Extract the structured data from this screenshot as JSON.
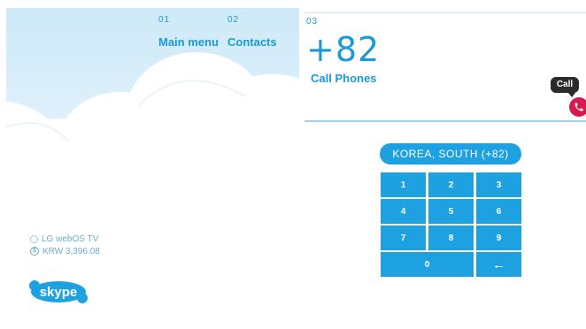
{
  "nav": {
    "main_menu": {
      "num": "01",
      "label": "Main menu"
    },
    "contacts": {
      "num": "02",
      "label": "Contacts"
    }
  },
  "account": {
    "device": "LG webOS TV",
    "credit": "KRW 3,396.08",
    "credit_icon": "$"
  },
  "logo": {
    "text": "skype"
  },
  "dialer": {
    "step_num": "03",
    "number": "+82",
    "subtitle": "Call Phones",
    "call_tooltip": "Call",
    "country": "KOREA, SOUTH (+82)",
    "keys": [
      "1",
      "2",
      "3",
      "4",
      "5",
      "6",
      "7",
      "8",
      "9",
      "0"
    ],
    "backspace_icon": "←"
  },
  "colors": {
    "accent": "#1da1e0",
    "text_blue": "#1a9ad6",
    "call_red": "#d8194f",
    "sky": "#cde9f8"
  }
}
